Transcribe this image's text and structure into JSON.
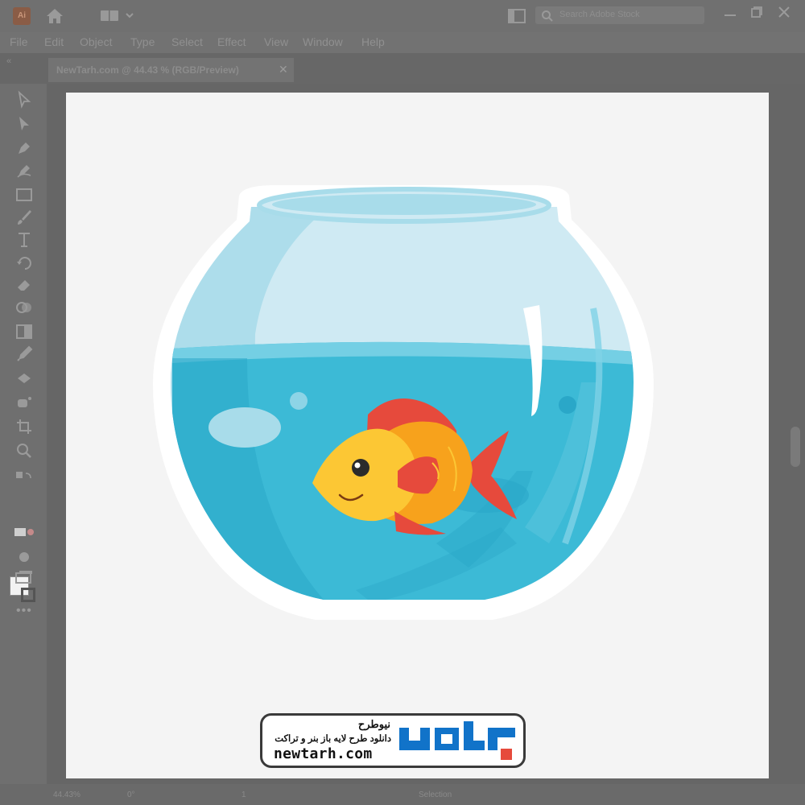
{
  "app": {
    "logo_text": "Ai",
    "search_placeholder": "Search Adobe Stock"
  },
  "menu": [
    "File",
    "Edit",
    "Object",
    "Type",
    "Select",
    "Effect",
    "View",
    "Window",
    "Help"
  ],
  "document_tab": {
    "label": "NewTarh.com @ 44.43 % (RGB/Preview)",
    "close": "✕"
  },
  "status": {
    "zoom": "44.43%",
    "rotation": "0°",
    "artboard": "1",
    "tool": "Selection"
  },
  "logo": {
    "fa_title": "نیوطرح",
    "fa_subtitle": "دانلود طرح لایه باز بنر و تراکت",
    "url": "newtarh.com",
    "mark_text": "نیوطرح"
  },
  "colors": {
    "bowl_glass": "#a8dcea",
    "water": "#3cbad6",
    "fish_body": "#f7a21c",
    "fish_head": "#fcc734",
    "fish_fin": "#e64a3c",
    "logo_mark": "#1173c9"
  }
}
